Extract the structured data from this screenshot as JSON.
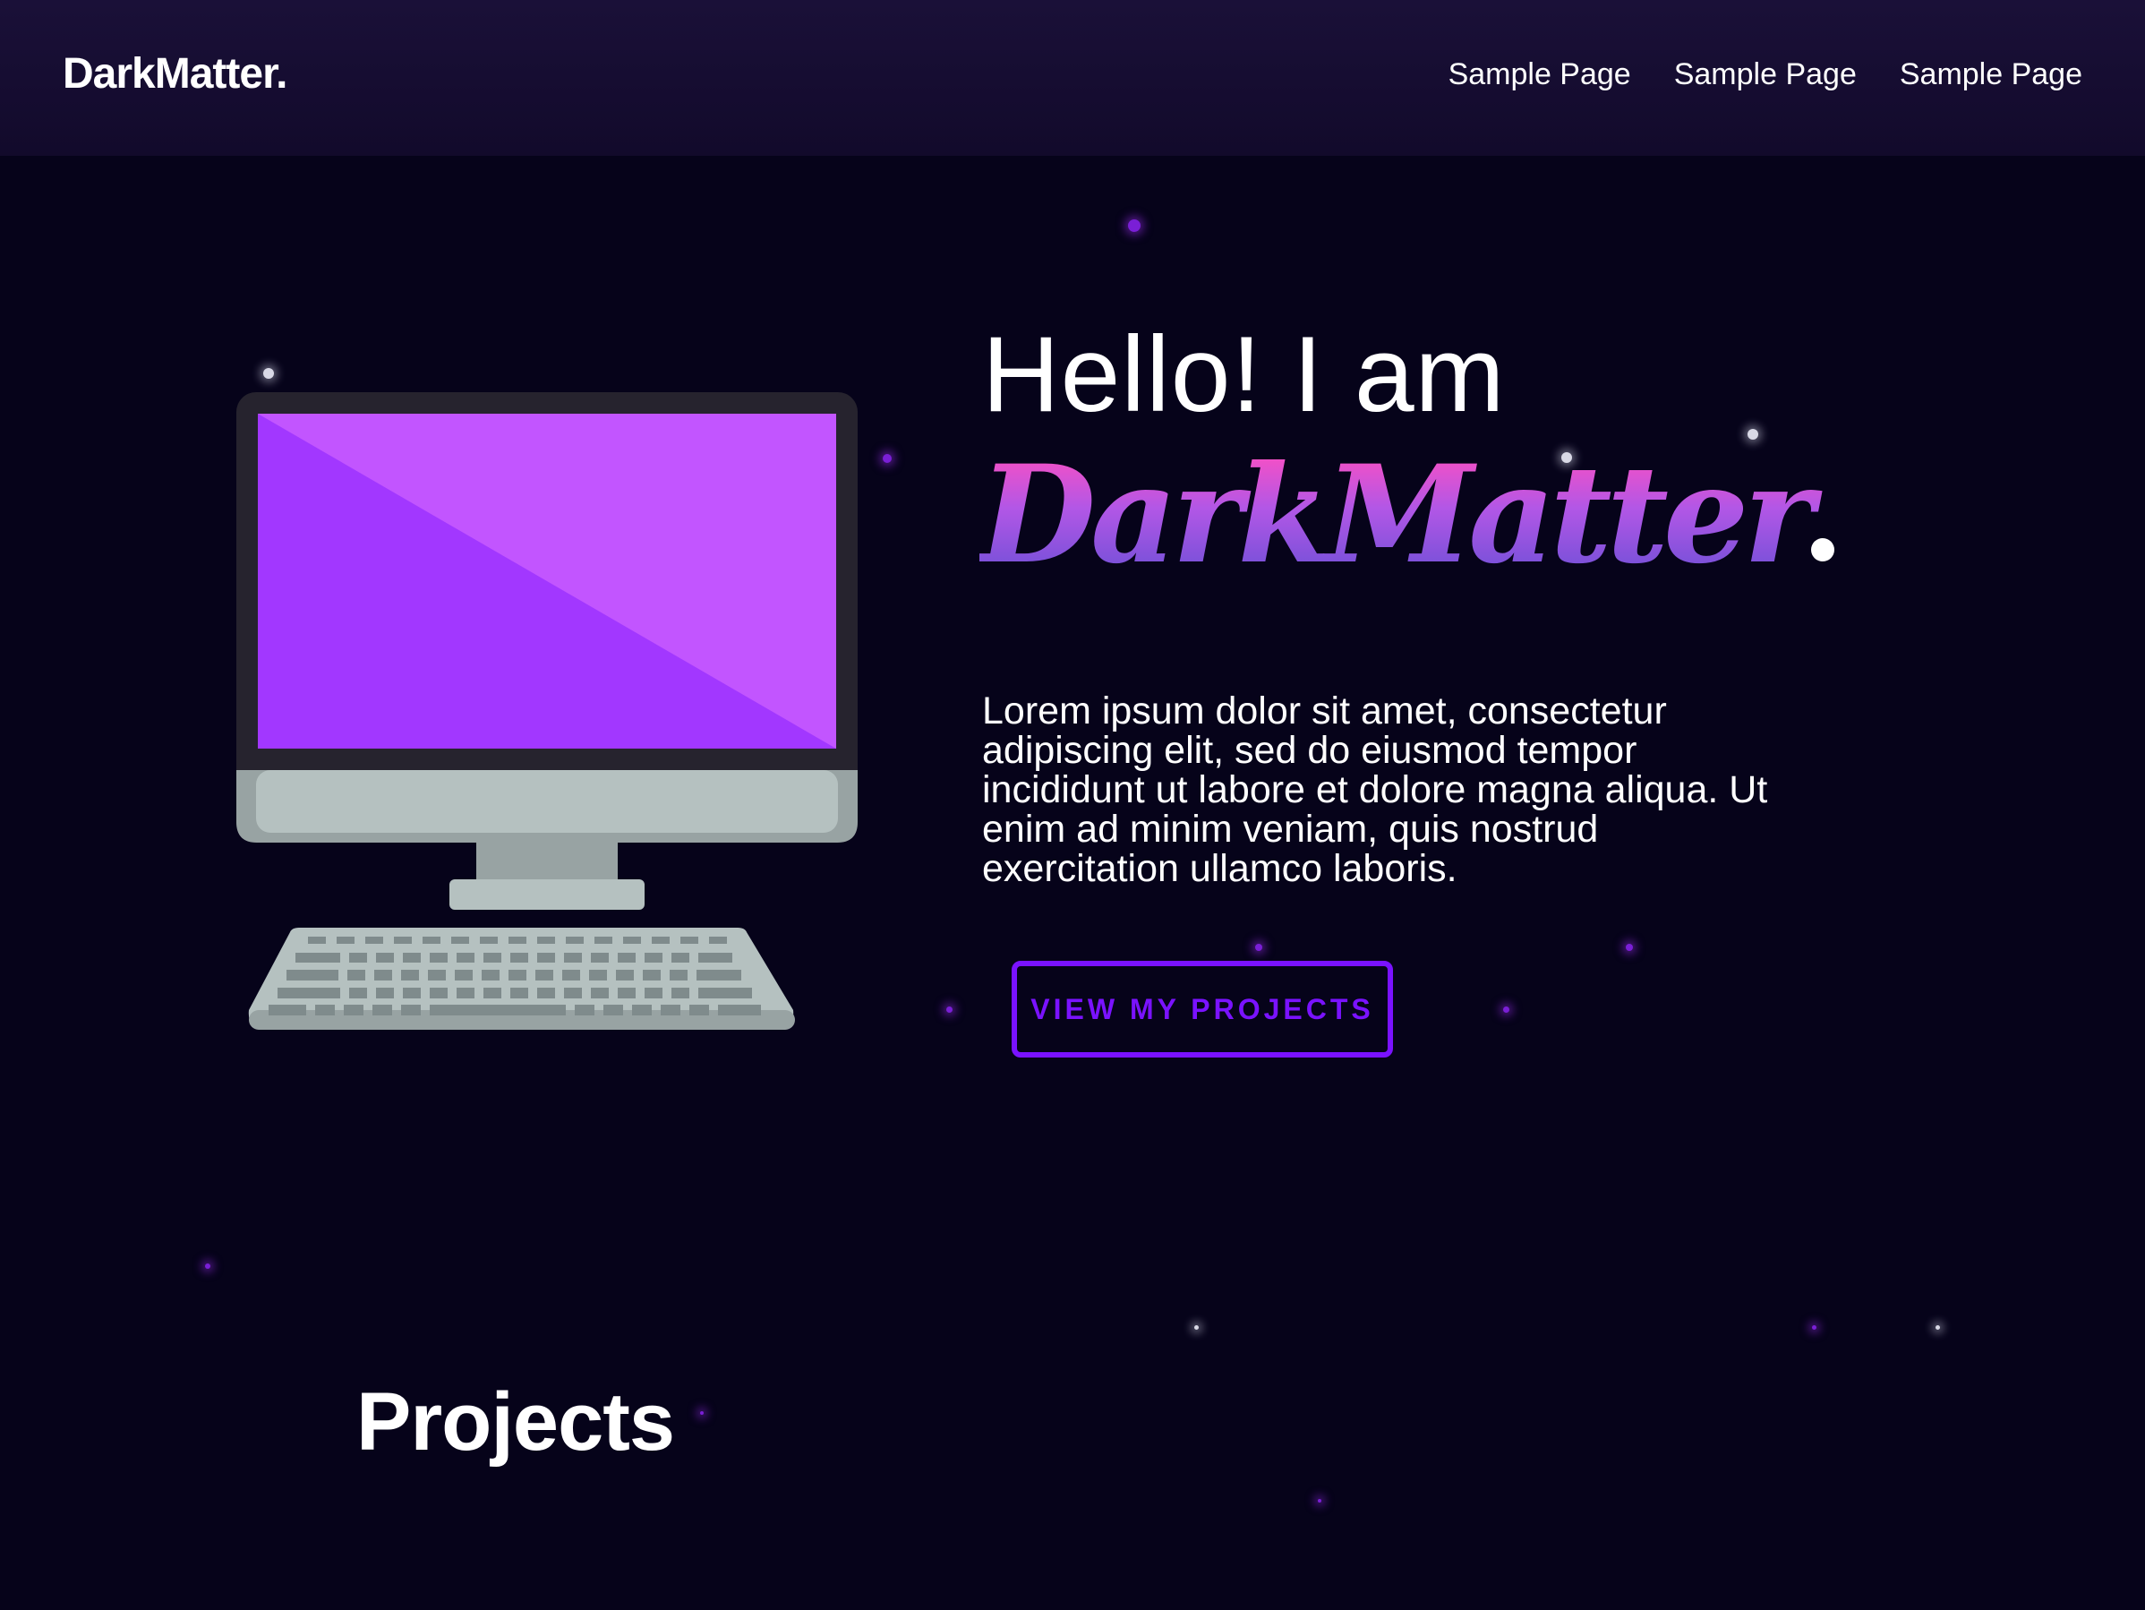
{
  "header": {
    "brand": "DarkMatter.",
    "nav": [
      "Sample Page",
      "Sample Page",
      "Sample Page"
    ]
  },
  "hero": {
    "greeting": "Hello! I am",
    "name": "DarkMatter",
    "description": "Lorem ipsum dolor sit amet, consectetur adipiscing elit, sed do eiusmod tempor incididunt ut labore et dolore magna aliqua. Ut enim ad minim veniam, quis nostrud exercitation ullamco laboris.",
    "cta_label": "VIEW MY PROJECTS",
    "illustration": "desktop-computer-icon"
  },
  "projects": {
    "title": "Projects"
  },
  "colors": {
    "background": "#06031a",
    "header": "#1a1038",
    "accent": "#7a12ff",
    "name_gradient_top": "#ff4fc1",
    "name_gradient_bottom": "#6c4fd6",
    "screen": "#a237ff"
  }
}
